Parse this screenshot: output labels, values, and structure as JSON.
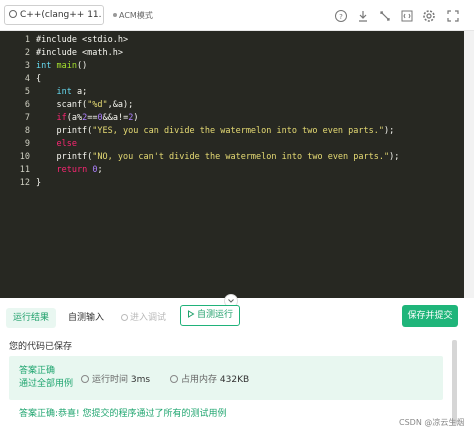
{
  "toolbar": {
    "language": "C++(clang++ 11.",
    "mode": "ACM模式",
    "icons": [
      "help-icon",
      "download-icon",
      "fullscreen-icon",
      "code-icon",
      "settings-icon",
      "expand-icon"
    ]
  },
  "editor": {
    "lines": [
      {
        "n": "1",
        "html": "<span class=\"pp\">#include &lt;stdio.h&gt;</span>"
      },
      {
        "n": "2",
        "html": "<span class=\"pp\">#include &lt;math.h&gt;</span>"
      },
      {
        "n": "3",
        "html": "<span class=\"kw\">int</span> <span class=\"fn\">main</span>()"
      },
      {
        "n": "4",
        "html": "{"
      },
      {
        "n": "5",
        "html": "    <span class=\"kw\">int</span> a;"
      },
      {
        "n": "6",
        "html": "    scanf(<span class=\"str\">\"%d\"</span>,&amp;a);"
      },
      {
        "n": "7",
        "html": "    <span class=\"kw2\">if</span>(a%<span class=\"num\">2</span>==<span class=\"num\">0</span>&amp;&amp;a!=<span class=\"num\">2</span>)"
      },
      {
        "n": "8",
        "html": "    printf(<span class=\"str\">\"YES, you can divide the watermelon into two even parts.\"</span>);"
      },
      {
        "n": "9",
        "html": "    <span class=\"kw2\">else</span>"
      },
      {
        "n": "10",
        "html": "    printf(<span class=\"str\">\"NO, you can't divide the watermelon into two even parts.\"</span>);"
      },
      {
        "n": "11",
        "html": "    <span class=\"kw2\">return</span> <span class=\"num\">0</span>;"
      },
      {
        "n": "12",
        "html": "}"
      }
    ]
  },
  "panel": {
    "tab_result": "运行结果",
    "tab_input": "自测输入",
    "tab_debug": "进入调试",
    "btn_selftest": "自测运行",
    "btn_save": "保存并提交",
    "saved": "您的代码已保存",
    "result_title": "答案正确",
    "result_sub": "通过全部用例",
    "time_label": "运行时间",
    "time_value": "3ms",
    "mem_label": "占用内存",
    "mem_value": "432KB",
    "congrats": "答案正确:恭喜! 您提交的程序通过了所有的测试用例",
    "watermark": "CSDN @凉云生烟"
  },
  "colors": {
    "accent": "#1fb57a",
    "editor_bg": "#272822"
  }
}
